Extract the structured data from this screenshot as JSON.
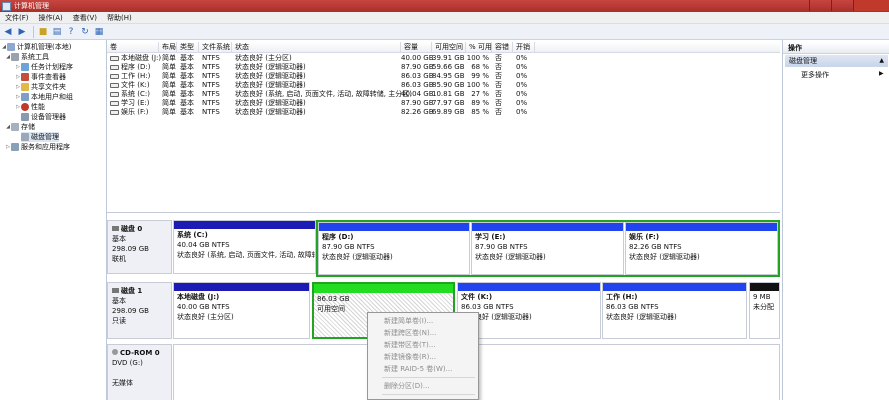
{
  "window": {
    "title": "计算机管理"
  },
  "menu": [
    "文件(F)",
    "操作(A)",
    "查看(V)",
    "帮助(H)"
  ],
  "toolbar": [
    "back-icon",
    "forward-icon",
    "up-folder-icon",
    "show-tree-icon",
    "help-icon",
    "refresh-icon",
    "properties-icon"
  ],
  "tree": [
    {
      "label": "计算机管理(本地)",
      "icon": "computer-icon"
    },
    {
      "label": "系统工具",
      "icon": "tools-icon"
    },
    {
      "label": "任务计划程序",
      "icon": "clock-icon"
    },
    {
      "label": "事件查看器",
      "icon": "event-icon"
    },
    {
      "label": "共享文件夹",
      "icon": "folder-icon"
    },
    {
      "label": "本地用户和组",
      "icon": "users-icon"
    },
    {
      "label": "性能",
      "icon": "performance-icon"
    },
    {
      "label": "设备管理器",
      "icon": "device-icon"
    },
    {
      "label": "存储",
      "icon": "storage-icon"
    },
    {
      "label": "磁盘管理",
      "icon": "disk-icon"
    },
    {
      "label": "服务和应用程序",
      "icon": "services-icon"
    }
  ],
  "volumes": {
    "headers": [
      "卷",
      "布局",
      "类型",
      "文件系统",
      "状态",
      "容量",
      "可用空间",
      "% 可用",
      "容错",
      "开销"
    ],
    "rows": [
      [
        "本地磁盘 (J:)",
        "简单",
        "基本",
        "NTFS",
        "状态良好 (主分区)",
        "40.00 GB",
        "39.91 GB",
        "100 %",
        "否",
        "0%"
      ],
      [
        "程序 (D:)",
        "简单",
        "基本",
        "NTFS",
        "状态良好 (逻辑驱动器)",
        "87.90 GB",
        "59.66 GB",
        "68 %",
        "否",
        "0%"
      ],
      [
        "工作 (H:)",
        "简单",
        "基本",
        "NTFS",
        "状态良好 (逻辑驱动器)",
        "86.03 GB",
        "84.95 GB",
        "99 %",
        "否",
        "0%"
      ],
      [
        "文件 (K:)",
        "简单",
        "基本",
        "NTFS",
        "状态良好 (逻辑驱动器)",
        "86.03 GB",
        "85.90 GB",
        "100 %",
        "否",
        "0%"
      ],
      [
        "系统 (C:)",
        "简单",
        "基本",
        "NTFS",
        "状态良好 (系统, 启动, 页面文件, 活动, 故障转储, 主分区)",
        "40.04 GB",
        "10.81 GB",
        "27 %",
        "否",
        "0%"
      ],
      [
        "学习 (E:)",
        "简单",
        "基本",
        "NTFS",
        "状态良好 (逻辑驱动器)",
        "87.90 GB",
        "77.97 GB",
        "89 %",
        "否",
        "0%"
      ],
      [
        "娱乐 (F:)",
        "简单",
        "基本",
        "NTFS",
        "状态良好 (逻辑驱动器)",
        "82.26 GB",
        "69.89 GB",
        "85 %",
        "否",
        "0%"
      ]
    ]
  },
  "disks": [
    {
      "name": "磁盘 0",
      "type": "基本",
      "size": "298.09 GB",
      "status": "联机",
      "partitions": [
        {
          "name": "系统  (C:)",
          "size": "40.04 GB NTFS",
          "status": "状态良好 (系统, 启动, 页面文件, 活动, 故障转储, 主分区)"
        },
        {
          "name": "程序  (D:)",
          "size": "87.90 GB NTFS",
          "status": "状态良好 (逻辑驱动器)"
        },
        {
          "name": "学习  (E:)",
          "size": "87.90 GB NTFS",
          "status": "状态良好 (逻辑驱动器)"
        },
        {
          "name": "娱乐  (F:)",
          "size": "82.26 GB NTFS",
          "status": "状态良好 (逻辑驱动器)"
        }
      ]
    },
    {
      "name": "磁盘 1",
      "type": "基本",
      "size": "298.09 GB",
      "status": "只读",
      "partitions": [
        {
          "name": "本地磁盘  (J:)",
          "size": "40.00 GB NTFS",
          "status": "状态良好 (主分区)"
        },
        {
          "name": "",
          "size": "86.03 GB",
          "status": "可用空间"
        },
        {
          "name": "文件  (K:)",
          "size": "86.03 GB NTFS",
          "status": "状态良好 (逻辑驱动器)"
        },
        {
          "name": "工作  (H:)",
          "size": "86.03 GB NTFS",
          "status": "状态良好 (逻辑驱动器)"
        },
        {
          "name": "",
          "size": "9 MB",
          "status": "未分配"
        }
      ]
    },
    {
      "name": "CD-ROM 0",
      "type": "DVD (G:)",
      "size": "",
      "status": "无媒体"
    }
  ],
  "context_menu": [
    "新建简单卷(I)...",
    "新建跨区卷(N)...",
    "新建带区卷(T)...",
    "新建镜像卷(R)...",
    "新建 RAID-5 卷(W)...",
    "删除分区(D)..."
  ],
  "actions": {
    "header": "操作",
    "section": "磁盘管理",
    "more": "更多操作"
  },
  "colors": {
    "primary_bar": "#1c1cb4",
    "logical_bar": "#2244ee",
    "free_bar": "#22dd22",
    "unallocated_bar": "#111111",
    "selection": "#22a322",
    "titlebar": "#b83a34"
  }
}
